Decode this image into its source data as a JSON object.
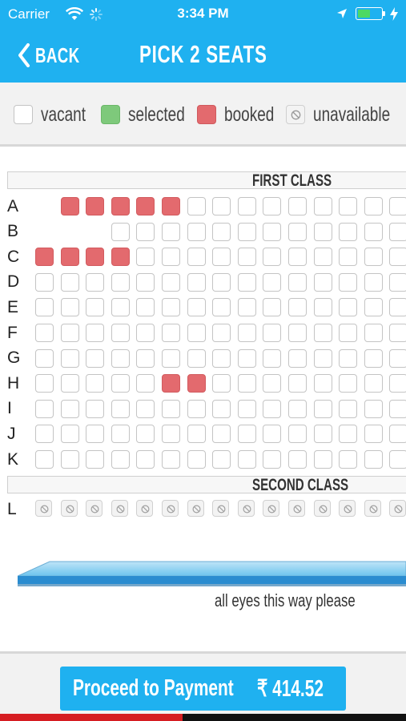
{
  "status_bar": {
    "carrier": "Carrier",
    "time": "3:34 PM",
    "battery_level": 0.55,
    "icons": [
      "wifi-icon",
      "activity-spinner-icon",
      "location-arrow-icon",
      "battery-icon",
      "charging-bolt-icon"
    ]
  },
  "header": {
    "back_label": "BACK",
    "title": "PICK 2 SEATS",
    "color": "#1fb1f0"
  },
  "legend": {
    "items": [
      {
        "key": "vacant",
        "label": "vacant",
        "color": "#ffffff"
      },
      {
        "key": "selected",
        "label": "selected",
        "color": "#7ec97b"
      },
      {
        "key": "booked",
        "label": "booked",
        "color": "#e36a6e"
      },
      {
        "key": "unavailable",
        "label": "unavailable",
        "color": "#f3f3f3"
      }
    ]
  },
  "seat_map": {
    "sections": [
      {
        "label": "FIRST CLASS",
        "rows": [
          {
            "label": "A",
            "seats": [
              "none",
              "booked",
              "booked",
              "booked",
              "booked",
              "booked",
              "vacant",
              "vacant",
              "vacant",
              "vacant",
              "vacant",
              "vacant",
              "vacant",
              "vacant",
              "vacant"
            ]
          },
          {
            "label": "B",
            "seats": [
              "none",
              "none",
              "none",
              "vacant",
              "vacant",
              "vacant",
              "vacant",
              "vacant",
              "vacant",
              "vacant",
              "vacant",
              "vacant",
              "vacant",
              "vacant",
              "vacant"
            ]
          },
          {
            "label": "C",
            "seats": [
              "booked",
              "booked",
              "booked",
              "booked",
              "vacant",
              "vacant",
              "vacant",
              "vacant",
              "vacant",
              "vacant",
              "vacant",
              "vacant",
              "vacant",
              "vacant",
              "vacant"
            ]
          },
          {
            "label": "D",
            "seats": [
              "vacant",
              "vacant",
              "vacant",
              "vacant",
              "vacant",
              "vacant",
              "vacant",
              "vacant",
              "vacant",
              "vacant",
              "vacant",
              "vacant",
              "vacant",
              "vacant",
              "vacant"
            ]
          },
          {
            "label": "E",
            "seats": [
              "vacant",
              "vacant",
              "vacant",
              "vacant",
              "vacant",
              "vacant",
              "vacant",
              "vacant",
              "vacant",
              "vacant",
              "vacant",
              "vacant",
              "vacant",
              "vacant",
              "vacant"
            ]
          },
          {
            "label": "F",
            "seats": [
              "vacant",
              "vacant",
              "vacant",
              "vacant",
              "vacant",
              "vacant",
              "vacant",
              "vacant",
              "vacant",
              "vacant",
              "vacant",
              "vacant",
              "vacant",
              "vacant",
              "vacant"
            ]
          },
          {
            "label": "G",
            "seats": [
              "vacant",
              "vacant",
              "vacant",
              "vacant",
              "vacant",
              "vacant",
              "vacant",
              "vacant",
              "vacant",
              "vacant",
              "vacant",
              "vacant",
              "vacant",
              "vacant",
              "vacant"
            ]
          },
          {
            "label": "H",
            "seats": [
              "vacant",
              "vacant",
              "vacant",
              "vacant",
              "vacant",
              "booked",
              "booked",
              "vacant",
              "vacant",
              "vacant",
              "vacant",
              "vacant",
              "vacant",
              "vacant",
              "vacant"
            ]
          },
          {
            "label": "I",
            "seats": [
              "vacant",
              "vacant",
              "vacant",
              "vacant",
              "vacant",
              "vacant",
              "vacant",
              "vacant",
              "vacant",
              "vacant",
              "vacant",
              "vacant",
              "vacant",
              "vacant",
              "vacant"
            ]
          },
          {
            "label": "J",
            "seats": [
              "vacant",
              "vacant",
              "vacant",
              "vacant",
              "vacant",
              "vacant",
              "vacant",
              "vacant",
              "vacant",
              "vacant",
              "vacant",
              "vacant",
              "vacant",
              "vacant",
              "vacant"
            ]
          },
          {
            "label": "K",
            "seats": [
              "vacant",
              "vacant",
              "vacant",
              "vacant",
              "vacant",
              "vacant",
              "vacant",
              "vacant",
              "vacant",
              "vacant",
              "vacant",
              "vacant",
              "vacant",
              "vacant",
              "vacant"
            ]
          }
        ]
      },
      {
        "label": "SECOND CLASS",
        "rows": [
          {
            "label": "L",
            "seats": [
              "unavailable",
              "unavailable",
              "unavailable",
              "unavailable",
              "unavailable",
              "unavailable",
              "unavailable",
              "unavailable",
              "unavailable",
              "unavailable",
              "unavailable",
              "unavailable",
              "unavailable",
              "unavailable",
              "unavailable"
            ]
          }
        ]
      }
    ]
  },
  "screen": {
    "note": "all eyes this way please"
  },
  "footer": {
    "pay_label": "Proceed to Payment",
    "amount": "₹ 414.52",
    "progress": 0.45,
    "progress_color": "#d61d22"
  }
}
